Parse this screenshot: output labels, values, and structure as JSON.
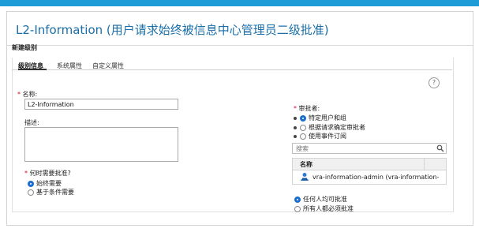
{
  "title": "L2-Information (用户请求始终被信息中心管理员二级批准)",
  "section": "新建级别",
  "tabs": [
    "级别信息",
    "系统属性",
    "自定义属性"
  ],
  "name_field": {
    "label": "名称:",
    "value": "L2-Information"
  },
  "desc_field": {
    "label": "描述:",
    "value": ""
  },
  "approval_when": {
    "label": "何时需要批准?",
    "options": [
      {
        "label": "始终需要",
        "selected": true
      },
      {
        "label": "基于条件需要",
        "selected": false
      }
    ]
  },
  "approver": {
    "label": "审批者:",
    "options": [
      {
        "label": "特定用户和组",
        "selected": true
      },
      {
        "label": "根据请求确定审批者",
        "selected": false
      },
      {
        "label": "使用事件订阅",
        "selected": false
      }
    ]
  },
  "search": {
    "placeholder": "搜索"
  },
  "table": {
    "header": "名称",
    "rows": [
      "vra-information-admin (vra-information-"
    ]
  },
  "approval_mode": {
    "options": [
      {
        "label": "任何人均可批准",
        "selected": true
      },
      {
        "label": "所有人都必须批准",
        "selected": false
      }
    ]
  },
  "help": "?",
  "colors": {
    "accent": "#1e9cd8",
    "title": "#1a6fa8",
    "required": "#c8102e",
    "radio": "#1c6fd1"
  }
}
